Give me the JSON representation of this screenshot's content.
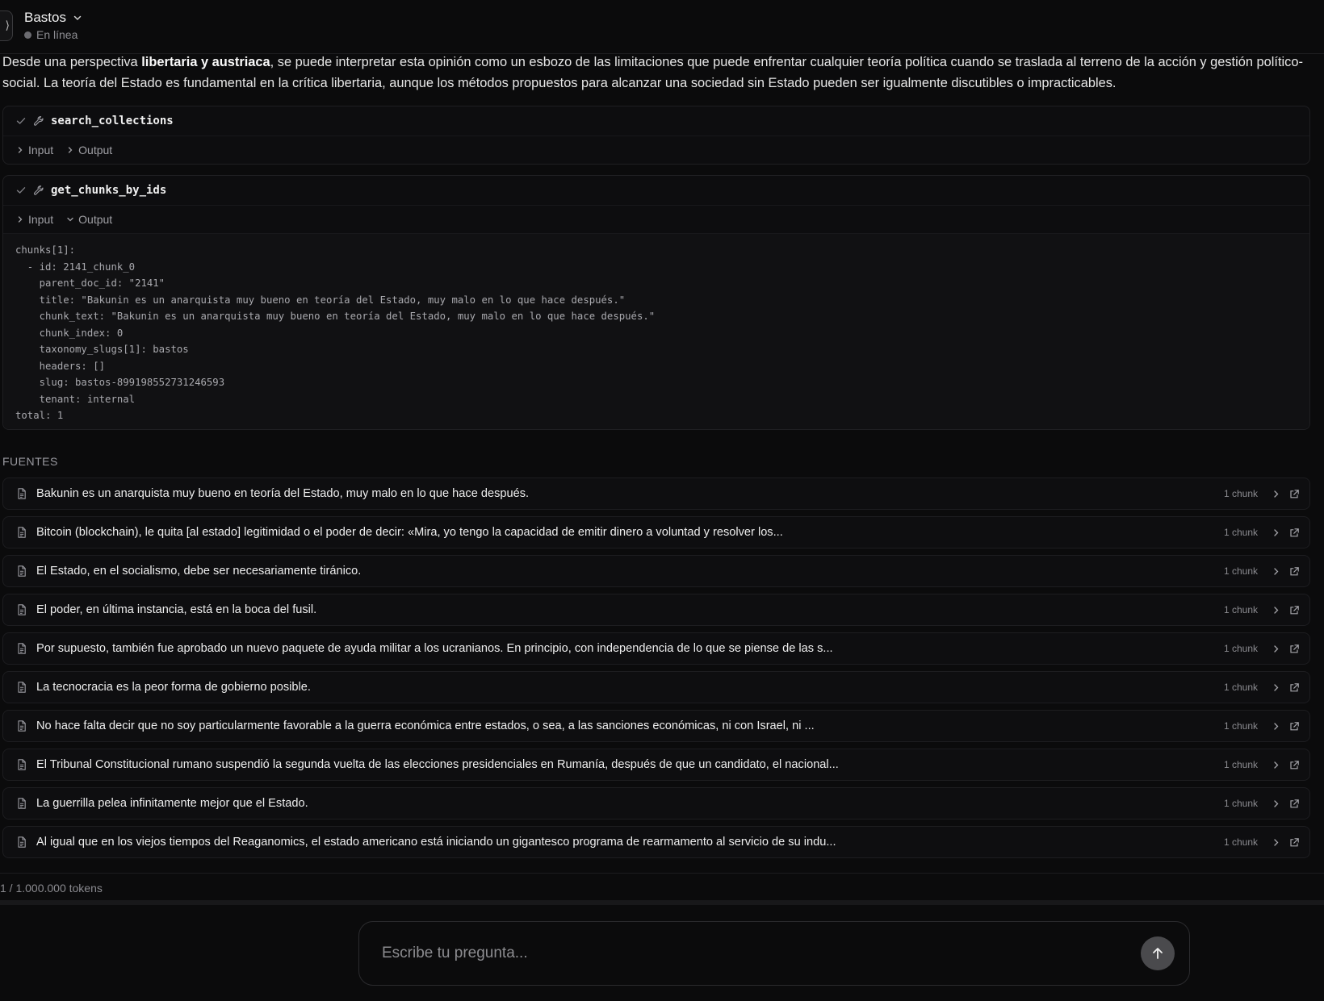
{
  "header": {
    "title": "Bastos",
    "status": "En línea"
  },
  "message": {
    "before_bold": "Desde una perspectiva ",
    "bold": "libertaria y austriaca",
    "after_bold": ", se puede interpretar esta opinión como un esbozo de las limitaciones que puede enfrentar cualquier teoría política cuando se traslada al terreno de la acción y gestión político-social. La teoría del Estado es fundamental en la crítica libertaria, aunque los métodos propuestos para alcanzar una sociedad sin Estado pueden ser igualmente discutibles o impracticables."
  },
  "tools": [
    {
      "name": "search_collections",
      "input_label": "Input",
      "output_label": "Output"
    },
    {
      "name": "get_chunks_by_ids",
      "input_label": "Input",
      "output_label": "Output",
      "output": "chunks[1]:\n  - id: 2141_chunk_0\n    parent_doc_id: \"2141\"\n    title: \"Bakunin es un anarquista muy bueno en teoría del Estado, muy malo en lo que hace después.\"\n    chunk_text: \"Bakunin es un anarquista muy bueno en teoría del Estado, muy malo en lo que hace después.\"\n    chunk_index: 0\n    taxonomy_slugs[1]: bastos\n    headers: []\n    slug: bastos-899198552731246593\n    tenant: internal\ntotal: 1"
    }
  ],
  "sources": {
    "label": "FUENTES",
    "items": [
      {
        "title": "Bakunin es un anarquista muy bueno en teoría del Estado, muy malo en lo que hace después.",
        "count": "1 chunk"
      },
      {
        "title": "Bitcoin (blockchain), le quita [al estado] legitimidad o el poder de decir: «Mira, yo tengo la capacidad de emitir dinero a voluntad y resolver los...",
        "count": "1 chunk"
      },
      {
        "title": "El Estado, en el socialismo, debe ser necesariamente tiránico.",
        "count": "1 chunk"
      },
      {
        "title": "El poder, en última instancia, está en la boca del fusil.",
        "count": "1 chunk"
      },
      {
        "title": "Por supuesto, también fue aprobado un nuevo paquete de ayuda militar a los ucranianos. En principio, con independencia de lo que se piense de las s...",
        "count": "1 chunk"
      },
      {
        "title": "La tecnocracia es la peor forma de gobierno posible.",
        "count": "1 chunk"
      },
      {
        "title": "No hace falta decir que no soy particularmente favorable a la guerra económica entre estados, o sea, a las sanciones económicas, ni con Israel, ni ...",
        "count": "1 chunk"
      },
      {
        "title": "El Tribunal Constitucional rumano suspendió la segunda vuelta de las elecciones presidenciales en Rumanía, después de que un candidato, el nacional...",
        "count": "1 chunk"
      },
      {
        "title": "La guerrilla pelea infinitamente mejor que el Estado.",
        "count": "1 chunk"
      },
      {
        "title": "Al igual que en los viejos tiempos del Reaganomics, el estado americano está iniciando un gigantesco programa de rearmamento al servicio de su indu...",
        "count": "1 chunk"
      }
    ]
  },
  "footer": {
    "tokens": "1 / 1.000.000 tokens",
    "input_placeholder": "Escribe tu pregunta...",
    "input_value": ""
  }
}
